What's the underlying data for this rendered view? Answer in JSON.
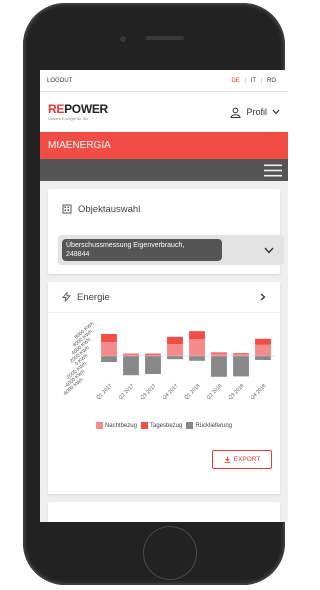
{
  "topbar": {
    "logout": "LOGOUT",
    "languages": [
      {
        "code": "DE",
        "active": true
      },
      {
        "code": "IT",
        "active": false
      },
      {
        "code": "RO",
        "active": false
      }
    ]
  },
  "header": {
    "logo": "REPOWER",
    "logo_prefix": "RE",
    "logo_suffix": "POWER",
    "tagline": "Unsere Energie für Sie.",
    "profile_label": "Profil"
  },
  "brand": {
    "title": "MIAENERGIA"
  },
  "object_card": {
    "title": "Objektauswahl",
    "selected_line1": "Überschussmessung Eigenverbrauch,",
    "selected_line2": "248844"
  },
  "energy_card": {
    "title": "Energie",
    "export_label": "EXPORT"
  },
  "colors": {
    "accent": "#f14d45",
    "nachtbezug": "#f48a8a",
    "tagesbezug": "#f14d45",
    "ruecklieferung": "#888888"
  },
  "chart_data": {
    "type": "bar",
    "stacked": true,
    "categories": [
      "Q1 2017",
      "Q2 2017",
      "Q3 2017",
      "Q4 2017",
      "Q1 2018",
      "Q2 2018",
      "Q3 2018",
      "Q4 2018"
    ],
    "y_ticks": [
      "8000 KWh",
      "6000 KWh",
      "4000 KWh",
      "2000 KWh",
      "0 KWh",
      "-2000 KWh",
      "-4000 KWh",
      "-6000 KWh"
    ],
    "ylim": [
      -6000,
      8000
    ],
    "series": [
      {
        "name": "Nachtbezug",
        "values": [
          3500,
          400,
          300,
          3000,
          4200,
          600,
          500,
          2800
        ]
      },
      {
        "name": "Tagesbezug",
        "values": [
          2000,
          200,
          300,
          1800,
          2000,
          300,
          200,
          1500
        ]
      },
      {
        "name": "Rücklieferung",
        "values": [
          -1500,
          -4800,
          -4500,
          -800,
          -1200,
          -5200,
          -5100,
          -1000
        ]
      }
    ],
    "legend_position": "bottom"
  }
}
